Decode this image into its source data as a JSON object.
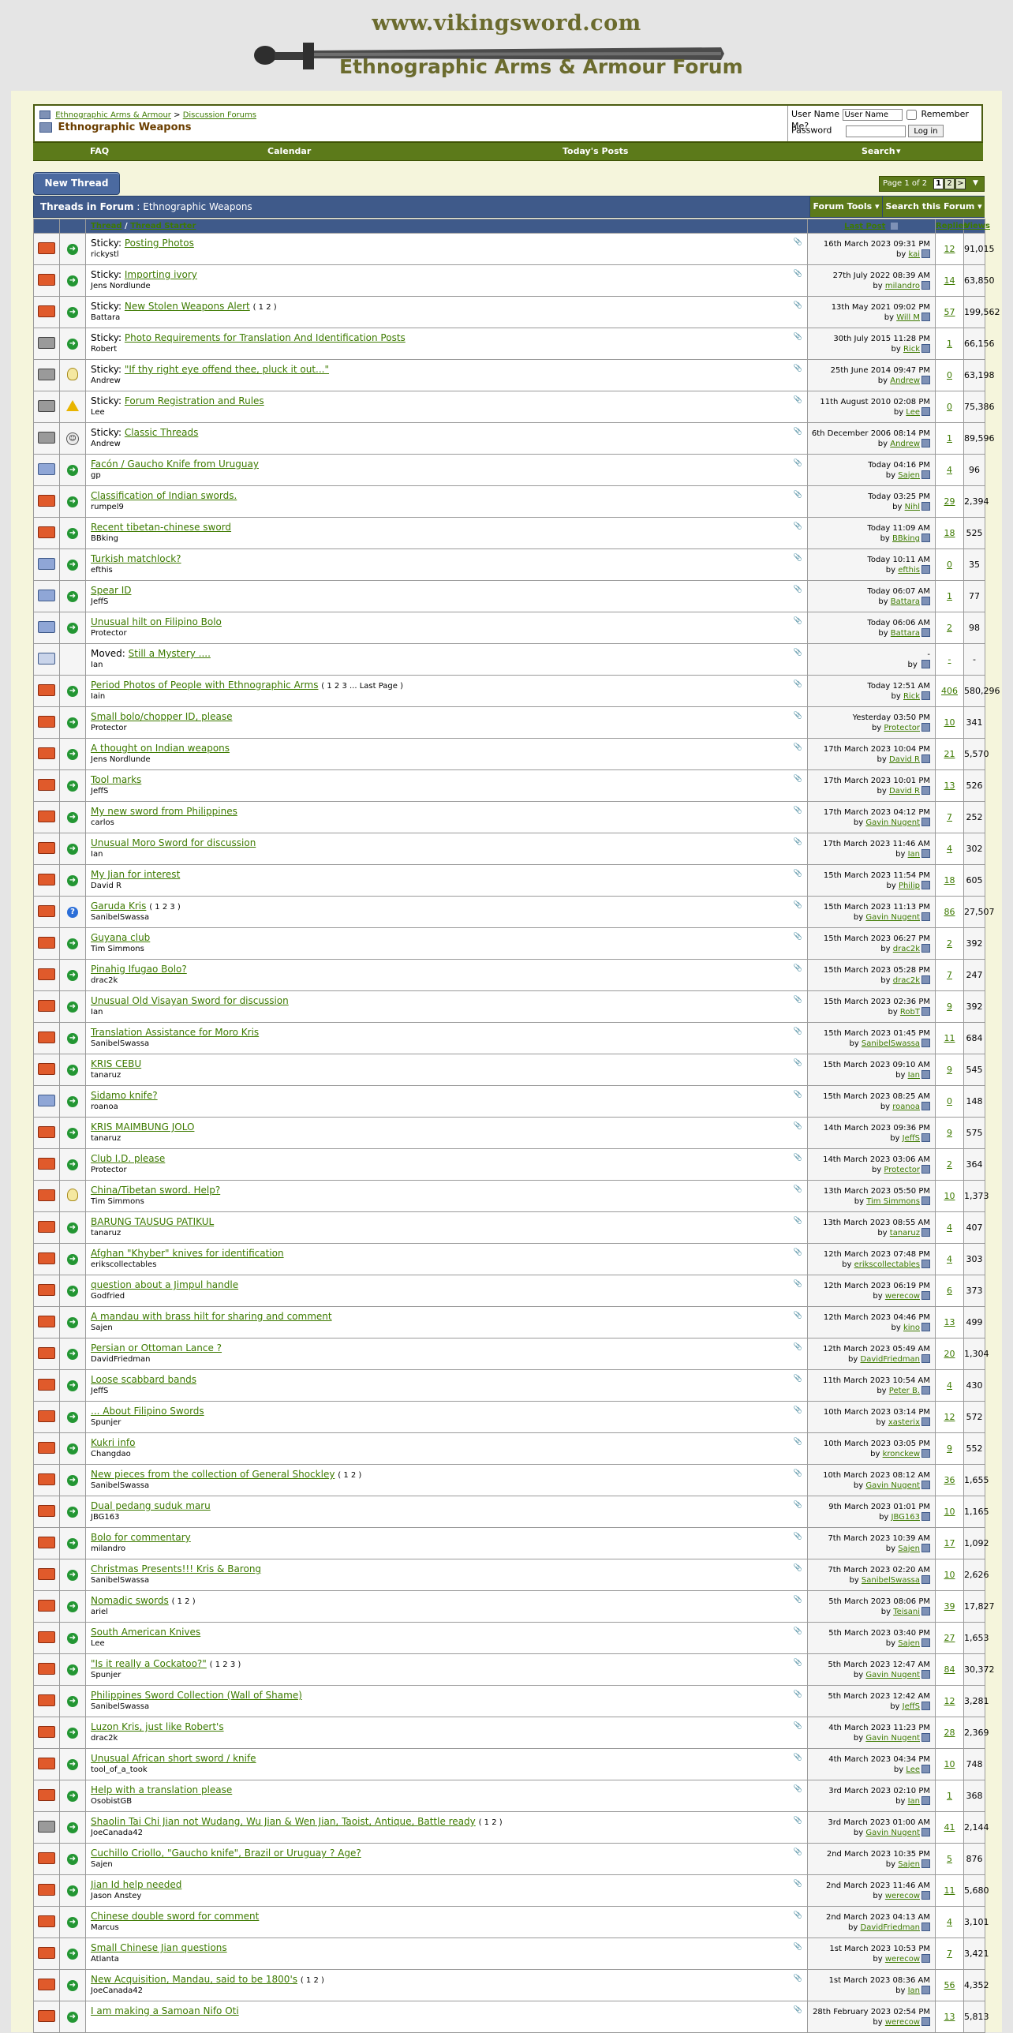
{
  "header": {
    "site_url": "www.vikingsword.com",
    "site_title": "Ethnographic Arms & Armour Forum"
  },
  "breadcrumb": {
    "root": "Ethnographic Arms & Armour",
    "separator": ">",
    "parent": "Discussion Forums",
    "current": "Ethnographic Weapons"
  },
  "login": {
    "username_label": "User Name",
    "username_value": "User Name",
    "remember_label": "Remember Me?",
    "password_label": "Password",
    "login_button": "Log in"
  },
  "navbar": {
    "faq": "FAQ",
    "calendar": "Calendar",
    "todays_posts": "Today's Posts",
    "search": "Search"
  },
  "toolbar": {
    "new_thread": "New Thread",
    "pager_label": "Page 1 of 2",
    "pager_current": "1",
    "pager_next": "2",
    "pager_next_arrow": ">"
  },
  "forum_header": {
    "title_prefix": "Threads in Forum",
    "title": "Ethnographic Weapons",
    "tools": "Forum Tools",
    "search_forum": "Search this Forum"
  },
  "columns": {
    "thread": "Thread",
    "separator": "/",
    "thread_starter": "Thread Starter",
    "last_post": "Last Post",
    "replies": "Replies",
    "views": "Views"
  },
  "threads": [
    {
      "prefix": "Sticky:",
      "title": "Posting Photos",
      "starter": "rickystl",
      "last_date": "16th March 2023 09:31 PM",
      "last_by": "kai",
      "replies": "12",
      "views": "91,015",
      "status": "hot",
      "icon": "arrow"
    },
    {
      "prefix": "Sticky:",
      "title": "Importing ivory",
      "starter": "Jens Nordlunde",
      "last_date": "27th July 2022 08:39 AM",
      "last_by": "milandro",
      "replies": "14",
      "views": "63,850",
      "status": "hot",
      "icon": "arrow"
    },
    {
      "prefix": "Sticky:",
      "title": "New Stolen Weapons Alert",
      "pages": "( 1 2 )",
      "starter": "Battara",
      "last_date": "13th May 2021 09:02 PM",
      "last_by": "Will M",
      "replies": "57",
      "views": "199,562",
      "status": "hot",
      "icon": "arrow"
    },
    {
      "prefix": "Sticky:",
      "title": "Photo Requirements for Translation And Identification Posts",
      "starter": "Robert",
      "last_date": "30th July 2015 11:28 PM",
      "last_by": "Rick",
      "replies": "1",
      "views": "66,156",
      "status": "lock",
      "icon": "arrow"
    },
    {
      "prefix": "Sticky:",
      "title": "\"If thy right eye offend thee, pluck it out...\"",
      "starter": "Andrew",
      "last_date": "25th June 2014 09:47 PM",
      "last_by": "Andrew",
      "replies": "0",
      "views": "63,198",
      "status": "lock",
      "icon": "bulb"
    },
    {
      "prefix": "Sticky:",
      "title": "Forum Registration and Rules",
      "starter": "Lee",
      "last_date": "11th August 2010 02:08 PM",
      "last_by": "Lee",
      "replies": "0",
      "views": "75,386",
      "status": "lock",
      "icon": "warn"
    },
    {
      "prefix": "Sticky:",
      "title": "Classic Threads",
      "starter": "Andrew",
      "last_date": "6th December 2006 08:14 PM",
      "last_by": "Andrew",
      "replies": "1",
      "views": "89,596",
      "status": "lock",
      "icon": "face"
    },
    {
      "prefix": "",
      "title": "Facón / Gaucho Knife from Uruguay",
      "starter": "gp",
      "last_date": "Today 04:16 PM",
      "last_by": "Sajen",
      "replies": "4",
      "views": "96",
      "status": "new",
      "icon": "arrow"
    },
    {
      "prefix": "",
      "title": "Classification of Indian swords.",
      "starter": "rumpel9",
      "last_date": "Today 03:25 PM",
      "last_by": "Nihl",
      "replies": "29",
      "views": "2,394",
      "status": "hot",
      "icon": "arrow"
    },
    {
      "prefix": "",
      "title": "Recent tibetan-chinese sword",
      "starter": "BBking",
      "last_date": "Today 11:09 AM",
      "last_by": "BBking",
      "replies": "18",
      "views": "525",
      "status": "hot",
      "icon": "arrow"
    },
    {
      "prefix": "",
      "title": "Turkish matchlock?",
      "starter": "efthis",
      "last_date": "Today 10:11 AM",
      "last_by": "efthis",
      "replies": "0",
      "views": "35",
      "status": "new",
      "icon": "arrow"
    },
    {
      "prefix": "",
      "title": "Spear ID",
      "starter": "JeffS",
      "last_date": "Today 06:07 AM",
      "last_by": "Battara",
      "replies": "1",
      "views": "77",
      "status": "new",
      "icon": "arrow"
    },
    {
      "prefix": "",
      "title": "Unusual hilt on Filipino Bolo",
      "starter": "Protector",
      "last_date": "Today 06:06 AM",
      "last_by": "Battara",
      "replies": "2",
      "views": "98",
      "status": "new",
      "icon": "arrow"
    },
    {
      "prefix": "Moved:",
      "title": "Still a Mystery ....",
      "starter": "Ian",
      "last_date": "-",
      "last_by": "",
      "replies": "-",
      "views": "-",
      "status": "moved",
      "icon": "none"
    },
    {
      "prefix": "",
      "title": "Period Photos of People with Ethnographic Arms",
      "pages": "( 1 2 3 ... Last Page )",
      "starter": "Iain",
      "last_date": "Today 12:51 AM",
      "last_by": "Rick",
      "replies": "406",
      "views": "580,296",
      "status": "hot",
      "icon": "arrow"
    },
    {
      "prefix": "",
      "title": "Small bolo/chopper ID, please",
      "starter": "Protector",
      "last_date": "Yesterday 03:50 PM",
      "last_by": "Protector",
      "replies": "10",
      "views": "341",
      "status": "hot",
      "icon": "arrow"
    },
    {
      "prefix": "",
      "title": "A thought on Indian weapons",
      "starter": "Jens Nordlunde",
      "last_date": "17th March 2023 10:04 PM",
      "last_by": "David R",
      "replies": "21",
      "views": "5,570",
      "status": "hot",
      "icon": "arrow"
    },
    {
      "prefix": "",
      "title": "Tool marks",
      "starter": "JeffS",
      "last_date": "17th March 2023 10:01 PM",
      "last_by": "David R",
      "replies": "13",
      "views": "526",
      "status": "hot",
      "icon": "arrow"
    },
    {
      "prefix": "",
      "title": "My new sword from Philippines",
      "starter": "carlos",
      "last_date": "17th March 2023 04:12 PM",
      "last_by": "Gavin Nugent",
      "replies": "7",
      "views": "252",
      "status": "hot",
      "icon": "arrow"
    },
    {
      "prefix": "",
      "title": "Unusual Moro Sword for discussion",
      "starter": "Ian",
      "last_date": "17th March 2023 11:46 AM",
      "last_by": "Ian",
      "replies": "4",
      "views": "302",
      "status": "hot",
      "icon": "arrow"
    },
    {
      "prefix": "",
      "title": "My Jian for interest",
      "starter": "David R",
      "last_date": "15th March 2023 11:54 PM",
      "last_by": "Philip",
      "replies": "18",
      "views": "605",
      "status": "hot",
      "icon": "arrow"
    },
    {
      "prefix": "",
      "title": "Garuda Kris",
      "pages": "( 1 2 3 )",
      "starter": "SanibelSwassa",
      "last_date": "15th March 2023 11:13 PM",
      "last_by": "Gavin Nugent",
      "replies": "86",
      "views": "27,507",
      "status": "hot",
      "icon": "question"
    },
    {
      "prefix": "",
      "title": "Guyana club",
      "starter": "Tim Simmons",
      "last_date": "15th March 2023 06:27 PM",
      "last_by": "drac2k",
      "replies": "2",
      "views": "392",
      "status": "hot",
      "icon": "arrow"
    },
    {
      "prefix": "",
      "title": "Pinahig Ifugao Bolo?",
      "starter": "drac2k",
      "last_date": "15th March 2023 05:28 PM",
      "last_by": "drac2k",
      "replies": "7",
      "views": "247",
      "status": "hot",
      "icon": "arrow"
    },
    {
      "prefix": "",
      "title": "Unusual Old Visayan Sword for discussion",
      "starter": "Ian",
      "last_date": "15th March 2023 02:36 PM",
      "last_by": "RobT",
      "replies": "9",
      "views": "392",
      "status": "hot",
      "icon": "arrow"
    },
    {
      "prefix": "",
      "title": "Translation Assistance for Moro Kris",
      "starter": "SanibelSwassa",
      "last_date": "15th March 2023 01:45 PM",
      "last_by": "SanibelSwassa",
      "replies": "11",
      "views": "684",
      "status": "hot",
      "icon": "arrow"
    },
    {
      "prefix": "",
      "title": "KRIS CEBU",
      "starter": "tanaruz",
      "last_date": "15th March 2023 09:10 AM",
      "last_by": "Ian",
      "replies": "9",
      "views": "545",
      "status": "hot",
      "icon": "arrow"
    },
    {
      "prefix": "",
      "title": "Sidamo knife?",
      "starter": "roanoa",
      "last_date": "15th March 2023 08:25 AM",
      "last_by": "roanoa",
      "replies": "0",
      "views": "148",
      "status": "new",
      "icon": "arrow"
    },
    {
      "prefix": "",
      "title": "KRIS MAIMBUNG JOLO",
      "starter": "tanaruz",
      "last_date": "14th March 2023 09:36 PM",
      "last_by": "JeffS",
      "replies": "9",
      "views": "575",
      "status": "hot",
      "icon": "arrow"
    },
    {
      "prefix": "",
      "title": "Club I.D. please",
      "starter": "Protector",
      "last_date": "14th March 2023 03:06 AM",
      "last_by": "Protector",
      "replies": "2",
      "views": "364",
      "status": "hot",
      "icon": "arrow"
    },
    {
      "prefix": "",
      "title": "China/Tibetan sword. Help?",
      "starter": "Tim Simmons",
      "last_date": "13th March 2023 05:50 PM",
      "last_by": "Tim Simmons",
      "replies": "10",
      "views": "1,373",
      "status": "hot",
      "icon": "bulb"
    },
    {
      "prefix": "",
      "title": "BARUNG TAUSUG PATIKUL",
      "starter": "tanaruz",
      "last_date": "13th March 2023 08:55 AM",
      "last_by": "tanaruz",
      "replies": "4",
      "views": "407",
      "status": "hot",
      "icon": "arrow"
    },
    {
      "prefix": "",
      "title": "Afghan \"Khyber\" knives for identification",
      "starter": "erikscollectables",
      "last_date": "12th March 2023 07:48 PM",
      "last_by": "erikscollectables",
      "replies": "4",
      "views": "303",
      "status": "hot",
      "icon": "arrow"
    },
    {
      "prefix": "",
      "title": "question about a Jimpul handle",
      "starter": "Godfried",
      "last_date": "12th March 2023 06:19 PM",
      "last_by": "werecow",
      "replies": "6",
      "views": "373",
      "status": "hot",
      "icon": "arrow"
    },
    {
      "prefix": "",
      "title": "A mandau with brass hilt for sharing and comment",
      "starter": "Sajen",
      "last_date": "12th March 2023 04:46 PM",
      "last_by": "kino",
      "replies": "13",
      "views": "499",
      "status": "hot",
      "icon": "arrow"
    },
    {
      "prefix": "",
      "title": "Persian or Ottoman Lance ?",
      "starter": "DavidFriedman",
      "last_date": "12th March 2023 05:49 AM",
      "last_by": "DavidFriedman",
      "replies": "20",
      "views": "1,304",
      "status": "hot",
      "icon": "arrow"
    },
    {
      "prefix": "",
      "title": "Loose scabbard bands",
      "starter": "JeffS",
      "last_date": "11th March 2023 10:54 AM",
      "last_by": "Peter B.",
      "replies": "4",
      "views": "430",
      "status": "hot",
      "icon": "arrow"
    },
    {
      "prefix": "",
      "title": "... About Filipino Swords",
      "starter": "Spunjer",
      "last_date": "10th March 2023 03:14 PM",
      "last_by": "xasterix",
      "replies": "12",
      "views": "572",
      "status": "hot",
      "icon": "arrow"
    },
    {
      "prefix": "",
      "title": "Kukri info",
      "starter": "Changdao",
      "last_date": "10th March 2023 03:05 PM",
      "last_by": "kronckew",
      "replies": "9",
      "views": "552",
      "status": "hot",
      "icon": "arrow"
    },
    {
      "prefix": "",
      "title": "New pieces from the collection of General Shockley",
      "pages": "( 1 2 )",
      "starter": "SanibelSwassa",
      "last_date": "10th March 2023 08:12 AM",
      "last_by": "Gavin Nugent",
      "replies": "36",
      "views": "1,655",
      "status": "hot",
      "icon": "arrow"
    },
    {
      "prefix": "",
      "title": "Dual pedang suduk maru",
      "starter": "JBG163",
      "last_date": "9th March 2023 01:01 PM",
      "last_by": "JBG163",
      "replies": "10",
      "views": "1,165",
      "status": "hot",
      "icon": "arrow"
    },
    {
      "prefix": "",
      "title": "Bolo for commentary",
      "starter": "milandro",
      "last_date": "7th March 2023 10:39 AM",
      "last_by": "Sajen",
      "replies": "17",
      "views": "1,092",
      "status": "hot",
      "icon": "arrow"
    },
    {
      "prefix": "",
      "title": "Christmas Presents!!! Kris & Barong",
      "starter": "SanibelSwassa",
      "last_date": "7th March 2023 02:20 AM",
      "last_by": "SanibelSwassa",
      "replies": "10",
      "views": "2,626",
      "status": "hot",
      "icon": "arrow"
    },
    {
      "prefix": "",
      "title": "Nomadic swords",
      "pages": "( 1 2 )",
      "starter": "ariel",
      "last_date": "5th March 2023 08:06 PM",
      "last_by": "Teisani",
      "replies": "39",
      "views": "17,827",
      "status": "hot",
      "icon": "arrow"
    },
    {
      "prefix": "",
      "title": "South American Knives",
      "starter": "Lee",
      "last_date": "5th March 2023 03:40 PM",
      "last_by": "Sajen",
      "replies": "27",
      "views": "1,653",
      "status": "hot",
      "icon": "arrow"
    },
    {
      "prefix": "",
      "title": "\"Is it really a Cockatoo?\"",
      "pages": "( 1 2 3 )",
      "starter": "Spunjer",
      "last_date": "5th March 2023 12:47 AM",
      "last_by": "Gavin Nugent",
      "replies": "84",
      "views": "30,372",
      "status": "hot",
      "icon": "arrow"
    },
    {
      "prefix": "",
      "title": "Philippines Sword Collection (Wall of Shame)",
      "starter": "SanibelSwassa",
      "last_date": "5th March 2023 12:42 AM",
      "last_by": "JeffS",
      "replies": "12",
      "views": "3,281",
      "status": "hot",
      "icon": "arrow"
    },
    {
      "prefix": "",
      "title": "Luzon Kris, just like Robert's",
      "starter": "drac2k",
      "last_date": "4th March 2023 11:23 PM",
      "last_by": "Gavin Nugent",
      "replies": "28",
      "views": "2,369",
      "status": "hot",
      "icon": "arrow"
    },
    {
      "prefix": "",
      "title": "Unusual African short sword / knife",
      "starter": "tool_of_a_took",
      "last_date": "4th March 2023 04:34 PM",
      "last_by": "Lee",
      "replies": "10",
      "views": "748",
      "status": "hot",
      "icon": "arrow"
    },
    {
      "prefix": "",
      "title": "Help with a translation please",
      "starter": "OsobistGB",
      "last_date": "3rd March 2023 02:10 PM",
      "last_by": "Ian",
      "replies": "1",
      "views": "368",
      "status": "hot",
      "icon": "arrow"
    },
    {
      "prefix": "",
      "title": "Shaolin Tai Chi Jian not Wudang, Wu Jian & Wen Jian, Taoist, Antique, Battle ready",
      "pages": "( 1 2 )",
      "starter": "JoeCanada42",
      "last_date": "3rd March 2023 01:00 AM",
      "last_by": "Gavin Nugent",
      "replies": "41",
      "views": "2,144",
      "status": "lock",
      "icon": "arrow"
    },
    {
      "prefix": "",
      "title": "Cuchillo Criollo, \"Gaucho knife\", Brazil or Uruguay ? Age?",
      "starter": "Sajen",
      "last_date": "2nd March 2023 10:35 PM",
      "last_by": "Sajen",
      "replies": "5",
      "views": "876",
      "status": "hot",
      "icon": "arrow"
    },
    {
      "prefix": "",
      "title": "Jian Id help needed",
      "starter": "Jason Anstey",
      "last_date": "2nd March 2023 11:46 AM",
      "last_by": "werecow",
      "replies": "11",
      "views": "5,680",
      "status": "hot",
      "icon": "arrow"
    },
    {
      "prefix": "",
      "title": "Chinese double sword for comment",
      "starter": "Marcus",
      "last_date": "2nd March 2023 04:13 AM",
      "last_by": "DavidFriedman",
      "replies": "4",
      "views": "3,101",
      "status": "hot",
      "icon": "arrow"
    },
    {
      "prefix": "",
      "title": "Small Chinese Jian questions",
      "starter": "Atlanta",
      "last_date": "1st March 2023 10:53 PM",
      "last_by": "werecow",
      "replies": "7",
      "views": "3,421",
      "status": "hot",
      "icon": "arrow"
    },
    {
      "prefix": "",
      "title": "New Acquisition, Mandau, said to be 1800's",
      "pages": "( 1 2 )",
      "starter": "JoeCanada42",
      "last_date": "1st March 2023 08:36 AM",
      "last_by": "Ian",
      "replies": "56",
      "views": "4,352",
      "status": "hot",
      "icon": "arrow"
    },
    {
      "prefix": "",
      "title": "I am making a Samoan Nifo Oti",
      "starter": "",
      "last_date": "28th February 2023 02:54 PM",
      "last_by": "werecow",
      "replies": "13",
      "views": "5,813",
      "status": "hot",
      "icon": "arrow"
    }
  ],
  "colors": {
    "nav_green": "#5c7a1a",
    "header_blue": "#3f5a8a",
    "link_green": "#3d7a00",
    "hot_folder": "#e05a2b"
  }
}
